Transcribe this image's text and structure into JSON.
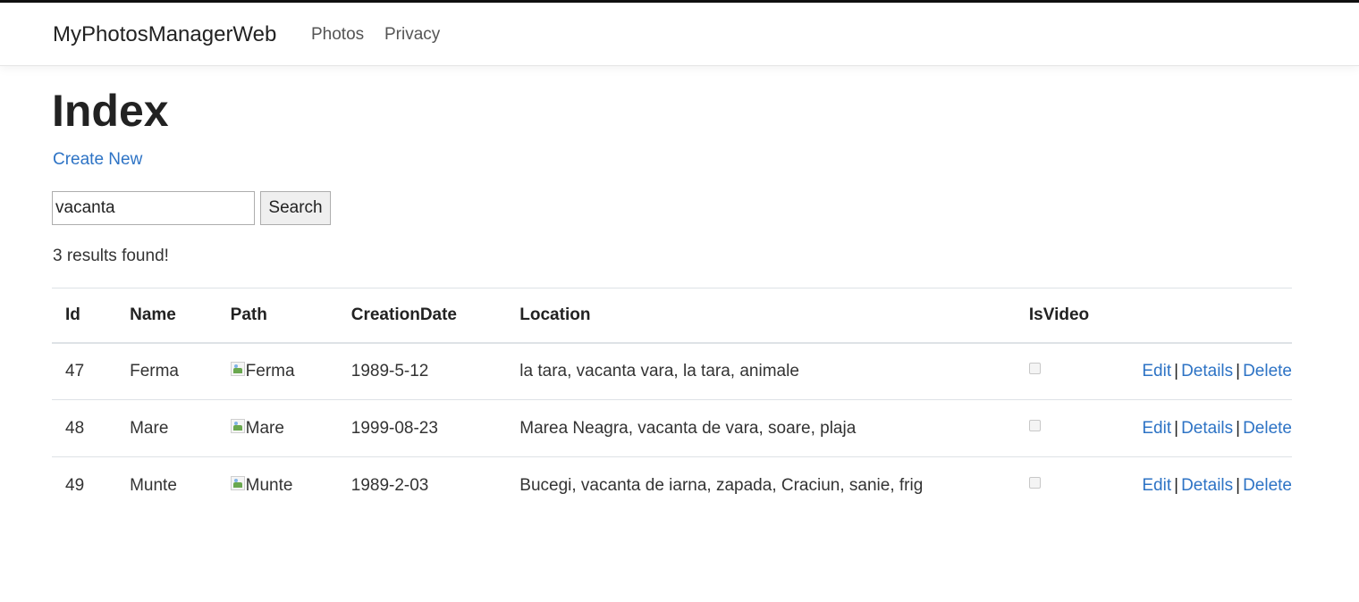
{
  "navbar": {
    "brand": "MyPhotosManagerWeb",
    "links": [
      "Photos",
      "Privacy"
    ]
  },
  "page": {
    "title": "Index",
    "create_new": "Create New",
    "search": {
      "value": "vacanta",
      "button": "Search"
    },
    "results_text": "3 results found!"
  },
  "table": {
    "headers": [
      "Id",
      "Name",
      "Path",
      "CreationDate",
      "Location",
      "IsVideo",
      ""
    ],
    "actions": {
      "edit": "Edit",
      "details": "Details",
      "delete": "Delete",
      "separator": "|"
    },
    "rows": [
      {
        "id": "47",
        "name": "Ferma",
        "path_alt": "Ferma",
        "date": "1989-5-12",
        "location": "la tara, vacanta vara, la tara, animale",
        "is_video": false
      },
      {
        "id": "48",
        "name": "Mare",
        "path_alt": "Mare",
        "date": "1999-08-23",
        "location": "Marea Neagra, vacanta de vara, soare, plaja",
        "is_video": false
      },
      {
        "id": "49",
        "name": "Munte",
        "path_alt": "Munte",
        "date": "1989-2-03",
        "location": "Bucegi, vacanta de iarna, zapada, Craciun, sanie, frig",
        "is_video": false
      }
    ]
  },
  "colors": {
    "link": "#2d73c5",
    "text": "#212529",
    "border": "#dee2e6"
  }
}
